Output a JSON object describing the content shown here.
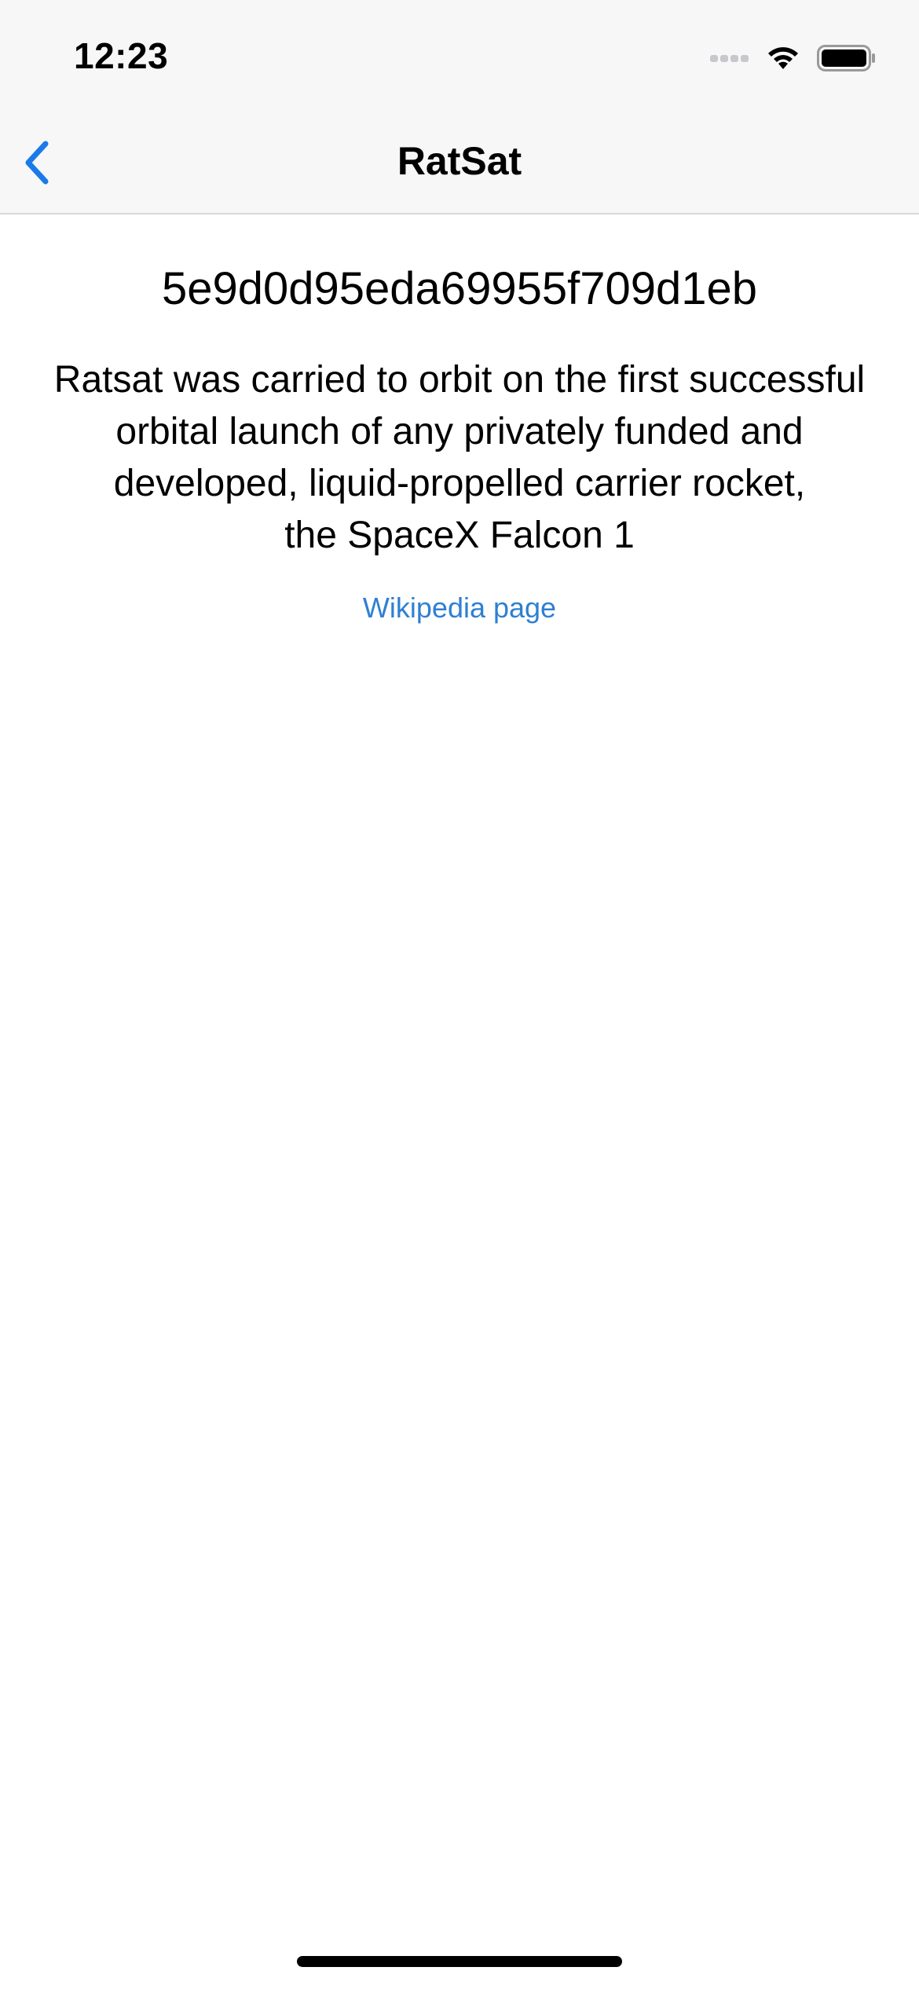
{
  "status_bar": {
    "time": "12:23",
    "signal_icon": "signal-dots-icon",
    "wifi_icon": "wifi-icon",
    "battery_icon": "battery-icon"
  },
  "nav": {
    "back_icon": "chevron-left-icon",
    "title": "RatSat",
    "accent_color": "#1a7ae8"
  },
  "detail": {
    "id": "5e9d0d95eda69955f709d1eb",
    "description_lines": [
      "Ratsat was carried to orbit on the first successful",
      "orbital launch of any privately funded and",
      "developed, liquid-propelled carrier rocket,",
      "the SpaceX Falcon 1"
    ],
    "link_label": "Wikipedia page",
    "link_color": "#2f80d1"
  }
}
